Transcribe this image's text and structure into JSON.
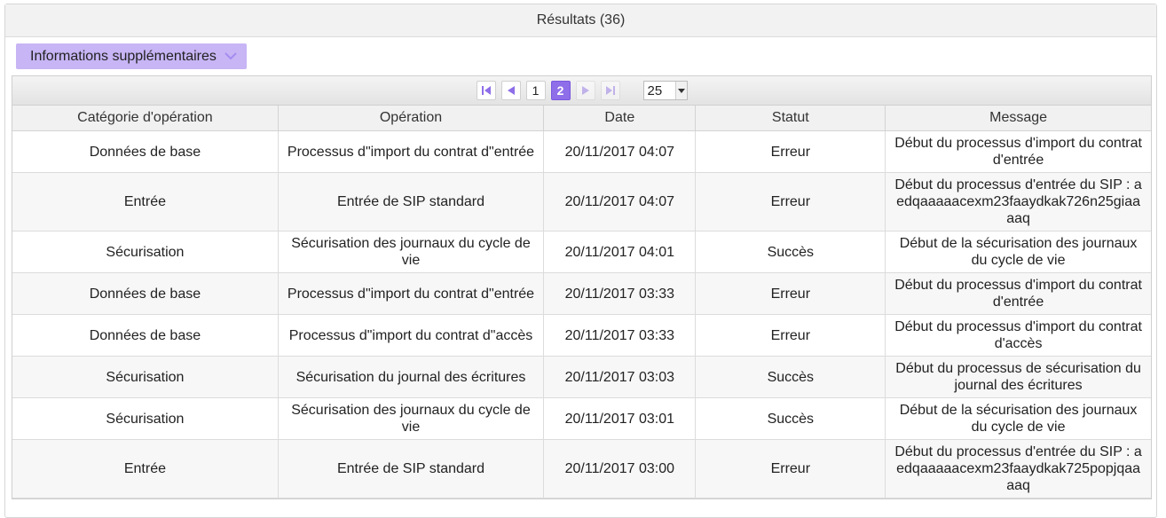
{
  "panel": {
    "title": "Résultats (36)"
  },
  "more_info_button": {
    "label": "Informations supplémentaires",
    "icon": "chevron-down-icon"
  },
  "paginator": {
    "first_icon": "first-page-icon",
    "prev_icon": "previous-page-icon",
    "next_icon": "next-page-icon",
    "last_icon": "last-page-icon",
    "pages": [
      "1",
      "2"
    ],
    "current_page": "2",
    "rows_per_page": "25",
    "accent_color": "#8e6ee9"
  },
  "table": {
    "columns": [
      "Catégorie d'opération",
      "Opération",
      "Date",
      "Statut",
      "Message"
    ],
    "rows": [
      [
        "Données de base",
        "Processus d\"import du contrat d\"entrée",
        "20/11/2017 04:07",
        "Erreur",
        "Début du processus d'import du contrat d'entrée"
      ],
      [
        "Entrée",
        "Entrée de SIP standard",
        "20/11/2017 04:07",
        "Erreur",
        "Début du processus d'entrée du SIP : aedqaaaaacexm23faaydkak726n25giaaaaq"
      ],
      [
        "Sécurisation",
        "Sécurisation des journaux du cycle de vie",
        "20/11/2017 04:01",
        "Succès",
        "Début de la sécurisation des journaux du cycle de vie"
      ],
      [
        "Données de base",
        "Processus d\"import du contrat d\"entrée",
        "20/11/2017 03:33",
        "Erreur",
        "Début du processus d'import du contrat d'entrée"
      ],
      [
        "Données de base",
        "Processus d\"import du contrat d\"accès",
        "20/11/2017 03:33",
        "Erreur",
        "Début du processus d'import du contrat d'accès"
      ],
      [
        "Sécurisation",
        "Sécurisation du journal des écritures",
        "20/11/2017 03:03",
        "Succès",
        "Début du processus de sécurisation du journal des écritures"
      ],
      [
        "Sécurisation",
        "Sécurisation des journaux du cycle de vie",
        "20/11/2017 03:01",
        "Succès",
        "Début de la sécurisation des journaux du cycle de vie"
      ],
      [
        "Entrée",
        "Entrée de SIP standard",
        "20/11/2017 03:00",
        "Erreur",
        "Début du processus d'entrée du SIP : aedqaaaaacexm23faaydkak725popjqaaaaq"
      ]
    ]
  }
}
